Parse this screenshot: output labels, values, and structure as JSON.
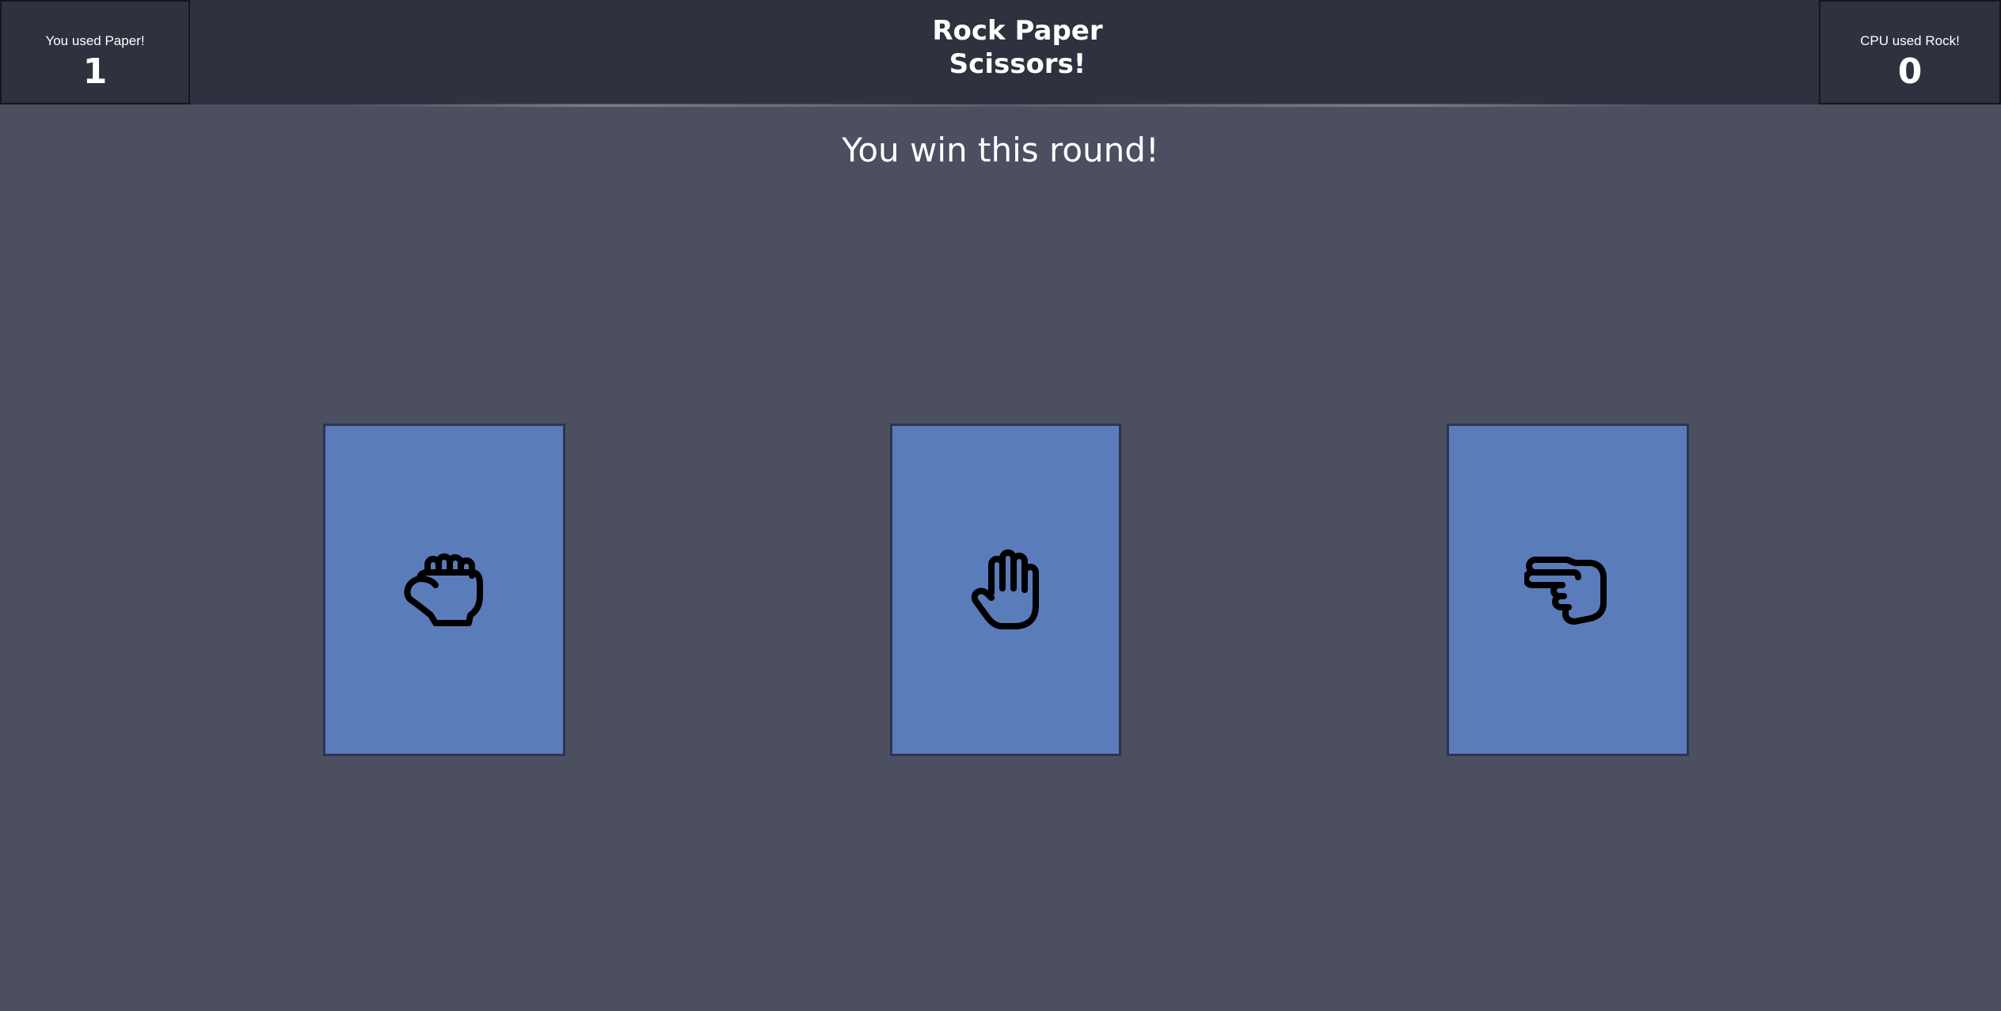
{
  "header": {
    "player": {
      "label": "You used Paper!",
      "score": "1"
    },
    "title_line1": "Rock Paper",
    "title_line2": "Scissors!",
    "cpu": {
      "label": "CPU used Rock!",
      "score": "0"
    }
  },
  "result_message": "You win this round!",
  "choices": [
    {
      "name": "Rock",
      "icon": "fist-icon"
    },
    {
      "name": "Paper",
      "icon": "open-hand-icon"
    },
    {
      "name": "Scissors",
      "icon": "scissors-hand-icon"
    }
  ],
  "colors": {
    "background": "#4b4f60",
    "header": "#2e313e",
    "card": "#5b7cba",
    "card_border": "#2c3450",
    "text": "#ffffff"
  }
}
